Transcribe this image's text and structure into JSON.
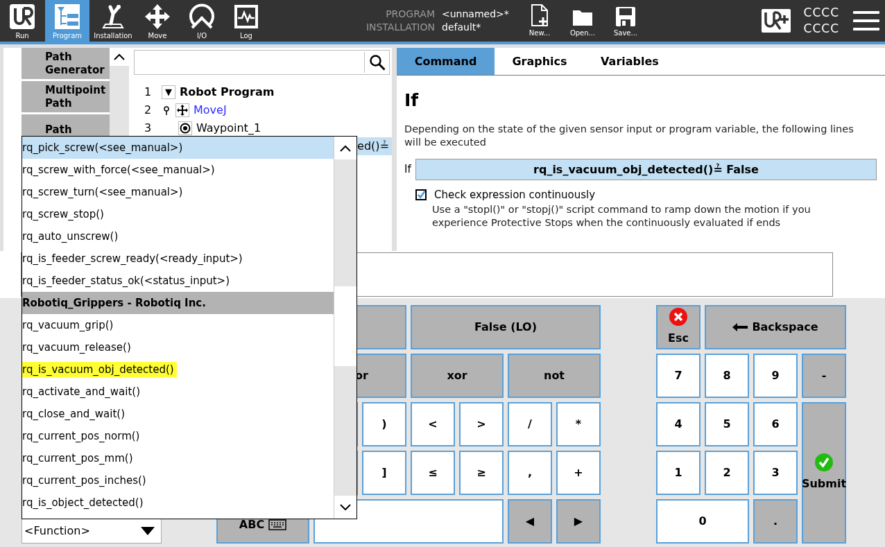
{
  "header": {
    "nav": [
      {
        "label": "Run",
        "kind": "run",
        "selected": false
      },
      {
        "label": "Program",
        "kind": "program",
        "selected": true
      },
      {
        "label": "Installation",
        "kind": "installation",
        "selected": false
      },
      {
        "label": "Move",
        "kind": "move",
        "selected": false
      },
      {
        "label": "I/O",
        "kind": "io",
        "selected": false
      },
      {
        "label": "Log",
        "kind": "log",
        "selected": false
      }
    ],
    "info": [
      {
        "label": "PROGRAM",
        "value": "<unnamed>*"
      },
      {
        "label": "INSTALLATION",
        "value": "default*"
      }
    ],
    "files": [
      {
        "label": "New...",
        "kind": "new"
      },
      {
        "label": "Open...",
        "kind": "open"
      },
      {
        "label": "Save...",
        "kind": "save"
      }
    ],
    "user": [
      "CCCC",
      "CCCC"
    ]
  },
  "sidebar": {
    "items": [
      "Path Generator",
      "Multipoint Path",
      "Path"
    ]
  },
  "tree": [
    {
      "number": "1",
      "label": "Robot Program",
      "kind": "program",
      "toggle": "▼",
      "selected": false,
      "children": [
        {
          "number": "2",
          "label": "MoveJ",
          "kind": "move",
          "selected": false,
          "children": [
            {
              "number": "3",
              "label": "Waypoint_1",
              "kind": "waypoint",
              "selected": false
            }
          ]
        },
        {
          "label": "ed()≟",
          "kind": "if",
          "selected": true
        }
      ]
    }
  ],
  "tabs": [
    {
      "label": "Command",
      "selected": true
    },
    {
      "label": "Graphics",
      "selected": false
    },
    {
      "label": "Variables",
      "selected": false
    }
  ],
  "command": {
    "title": "If",
    "description": "Depending on the state of the given sensor input or program variable, the following lines will be executed",
    "condition_label": "If",
    "expression": "rq_is_vacuum_obj_detected()≟ False",
    "checkbox": {
      "label": "Check expression continuously",
      "checked": true
    },
    "note": "Use a \"stopl()\" or \"stopj()\" script command to ramp down the motion if you experience Protective Stops when the continuously evaluated if ends"
  },
  "function_list": [
    {
      "label": "rq_pick_screw(<see_manual>)",
      "kind": "function",
      "selected": true,
      "highlighted": false
    },
    {
      "label": "rq_screw_with_force(<see_manual>)",
      "kind": "function",
      "selected": false,
      "highlighted": false
    },
    {
      "label": "rq_screw_turn(<see_manual>)",
      "kind": "function",
      "selected": false,
      "highlighted": false
    },
    {
      "label": "rq_screw_stop()",
      "kind": "function",
      "selected": false,
      "highlighted": false
    },
    {
      "label": "rq_auto_unscrew()",
      "kind": "function",
      "selected": false,
      "highlighted": false
    },
    {
      "label": "rq_is_feeder_screw_ready(<ready_input>)",
      "kind": "function",
      "selected": false,
      "highlighted": false
    },
    {
      "label": "rq_is_feeder_status_ok(<status_input>)",
      "kind": "function",
      "selected": false,
      "highlighted": false
    },
    {
      "label": "Robotiq_Grippers - Robotiq Inc.",
      "kind": "group",
      "selected": false,
      "highlighted": false
    },
    {
      "label": "rq_vacuum_grip()",
      "kind": "function",
      "selected": false,
      "highlighted": false
    },
    {
      "label": "rq_vacuum_release()",
      "kind": "function",
      "selected": false,
      "highlighted": false
    },
    {
      "label": "rq_is_vacuum_obj_detected()",
      "kind": "function",
      "selected": false,
      "highlighted": true
    },
    {
      "label": "rq_activate_and_wait()",
      "kind": "function",
      "selected": false,
      "highlighted": false
    },
    {
      "label": "rq_close_and_wait()",
      "kind": "function",
      "selected": false,
      "highlighted": false
    },
    {
      "label": "rq_current_pos_norm()",
      "kind": "function",
      "selected": false,
      "highlighted": false
    },
    {
      "label": "rq_current_pos_mm()",
      "kind": "function",
      "selected": false,
      "highlighted": false
    },
    {
      "label": "rq_current_pos_inches()",
      "kind": "function",
      "selected": false,
      "highlighted": false
    },
    {
      "label": "rq_is_object_detected()",
      "kind": "function",
      "selected": false,
      "highlighted": false
    }
  ],
  "function_select": {
    "value": "<Function>"
  },
  "keypad": [
    {
      "kind": "operator"
    },
    {
      "label": "False (LO)",
      "kind": "operator"
    },
    {
      "label": "or",
      "kind": "operator"
    },
    {
      "label": "xor",
      "kind": "operator"
    },
    {
      "label": "not",
      "kind": "operator"
    },
    {
      "kind": "value"
    },
    {
      "label": ")",
      "kind": "value"
    },
    {
      "label": "<",
      "kind": "value"
    },
    {
      "label": ">",
      "kind": "value"
    },
    {
      "label": "/",
      "kind": "value"
    },
    {
      "label": "*",
      "kind": "value"
    },
    {
      "kind": "value"
    },
    {
      "label": "]",
      "kind": "value"
    },
    {
      "label": "≤",
      "kind": "value"
    },
    {
      "label": "≥",
      "kind": "value"
    },
    {
      "label": ",",
      "kind": "value"
    },
    {
      "label": "+",
      "kind": "value"
    },
    {
      "label": "ABC",
      "kind": "keyboard"
    },
    {
      "kind": "field"
    },
    {
      "label": "◀",
      "kind": "operator"
    },
    {
      "label": "▶",
      "kind": "operator"
    }
  ],
  "numpad": [
    {
      "label": "Esc",
      "kind": "cancel"
    },
    {
      "label": "Backspace",
      "kind": "backspace"
    },
    {
      "label": "7",
      "kind": "value"
    },
    {
      "label": "8",
      "kind": "value"
    },
    {
      "label": "9",
      "kind": "value"
    },
    {
      "label": "-",
      "kind": "operator"
    },
    {
      "label": "4",
      "kind": "value"
    },
    {
      "label": "5",
      "kind": "value"
    },
    {
      "label": "6",
      "kind": "value"
    },
    {
      "label": "Submit",
      "kind": "submit"
    },
    {
      "label": "1",
      "kind": "value"
    },
    {
      "label": "2",
      "kind": "value"
    },
    {
      "label": "3",
      "kind": "value"
    },
    {
      "label": "0",
      "kind": "value"
    },
    {
      "label": ".",
      "kind": "operator"
    }
  ]
}
